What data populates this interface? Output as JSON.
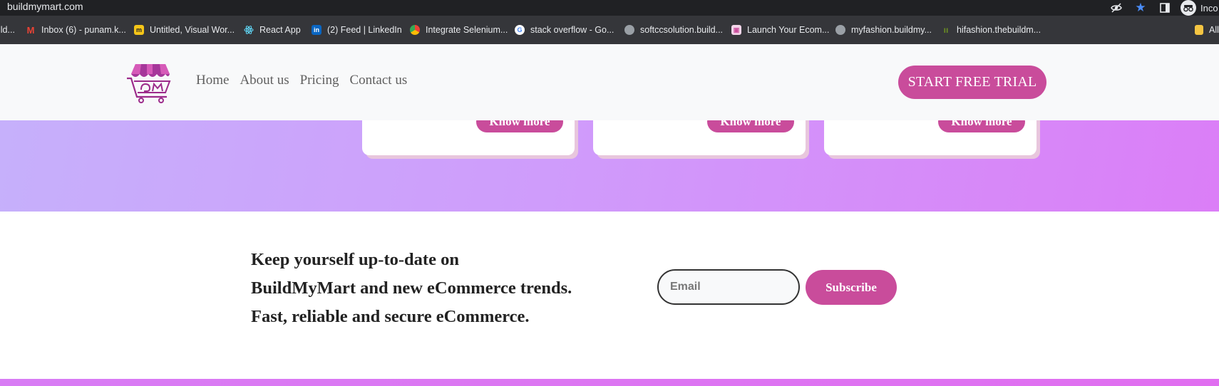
{
  "browser": {
    "url": "buildmymart.com",
    "profile_label": "Inco",
    "bookmarks": [
      {
        "label": "ild...",
        "icon": "folder-icon",
        "color": "#e8eaed"
      },
      {
        "label": "Inbox (6) - punam.k...",
        "icon": "gmail-icon",
        "color": "#ea4335"
      },
      {
        "label": "Untitled, Visual Wor...",
        "icon": "miro-icon",
        "color": "#f5c518"
      },
      {
        "label": "React App",
        "icon": "react-icon",
        "color": "#61dafb"
      },
      {
        "label": "(2) Feed | LinkedIn",
        "icon": "linkedin-icon",
        "color": "#0a66c2"
      },
      {
        "label": "Integrate Selenium...",
        "icon": "chrome-icon",
        "color": "#34a853"
      },
      {
        "label": "stack overflow - Go...",
        "icon": "google-icon",
        "color": "#ffffff"
      },
      {
        "label": "softccsolution.build...",
        "icon": "globe-icon",
        "color": "#9aa0a6"
      },
      {
        "label": "Launch Your Ecom...",
        "icon": "shop-icon",
        "color": "#c94c9b"
      },
      {
        "label": "myfashion.buildmy...",
        "icon": "globe-icon",
        "color": "#9aa0a6"
      },
      {
        "label": "hifashion.thebuildm...",
        "icon": "fashion-icon",
        "color": "#6b8e23"
      },
      {
        "label": "All",
        "icon": "folder-icon",
        "color": "#f4c542"
      }
    ]
  },
  "nav": {
    "links": [
      "Home",
      "About us",
      "Pricing",
      "Contact us"
    ],
    "cta": "START FREE TRIAL"
  },
  "cards": [
    {
      "button": "Know more"
    },
    {
      "button": "Know more"
    },
    {
      "button": "Know more"
    }
  ],
  "newsletter": {
    "line1": "Keep yourself up-to-date on",
    "line2": "BuildMyMart and new eCommerce trends.",
    "line3": "Fast, reliable and secure eCommerce.",
    "email_placeholder": "Email",
    "subscribe_label": "Subscribe"
  },
  "colors": {
    "accent": "#c94c9b",
    "logo": "#9c2b8a"
  }
}
